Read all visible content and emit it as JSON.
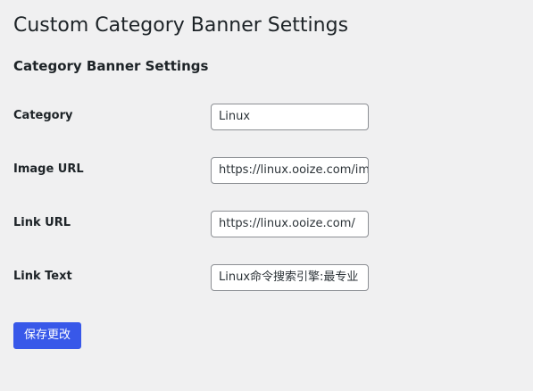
{
  "page": {
    "title": "Custom Category Banner Settings",
    "section_title": "Category Banner Settings"
  },
  "fields": {
    "category": {
      "label": "Category",
      "value": "Linux"
    },
    "image_url": {
      "label": "Image URL",
      "value": "https://linux.ooize.com/im"
    },
    "link_url": {
      "label": "Link URL",
      "value": "https://linux.ooize.com/"
    },
    "link_text": {
      "label": "Link Text",
      "value": "Linux命令搜索引擎:最专业"
    }
  },
  "actions": {
    "save_label": "保存更改"
  },
  "colors": {
    "background": "#f0f0f1",
    "primary_button": "#3858e9",
    "input_border": "#8c8f94"
  }
}
